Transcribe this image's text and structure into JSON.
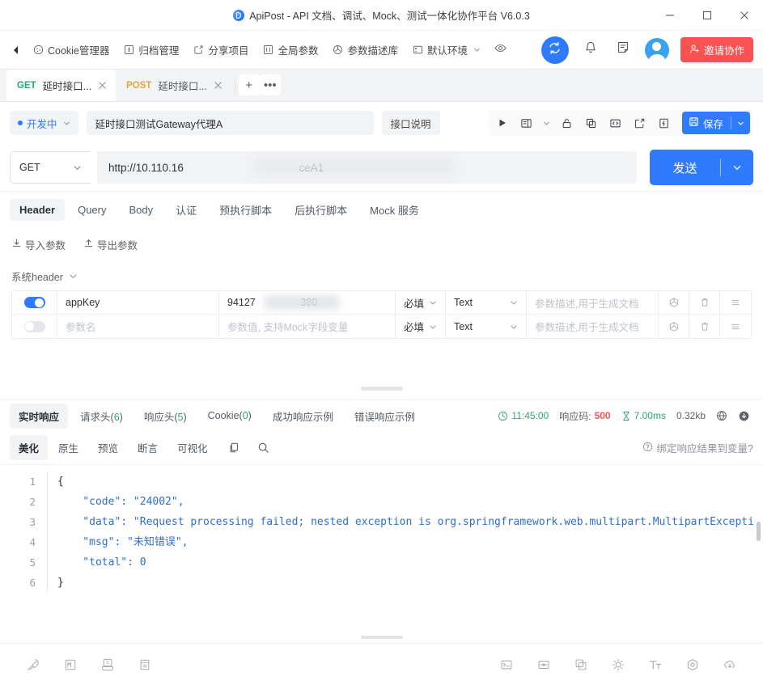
{
  "window": {
    "title": "ApiPost - API 文档、调试、Mock、测试一体化协作平台 V6.0.3",
    "minimize_label": "最小化",
    "maximize_label": "最大化",
    "close_label": "关闭"
  },
  "toolbar": {
    "back_label": "返回",
    "items": [
      {
        "label": "Cookie管理器",
        "icon": "cookie-icon"
      },
      {
        "label": "归档管理",
        "icon": "archive-icon"
      },
      {
        "label": "分享项目",
        "icon": "share-icon"
      },
      {
        "label": "全局参数",
        "icon": "global-params-icon"
      },
      {
        "label": "参数描述库",
        "icon": "param-library-icon"
      },
      {
        "label": "默认环境",
        "icon": "environment-icon",
        "has_chevron": true
      }
    ],
    "eye_icon": "eye-icon",
    "sync_icon": "sync-icon",
    "bell_icon": "bell-icon",
    "note_icon": "note-icon",
    "avatar": "user-avatar",
    "invite_label": "邀请协作"
  },
  "tabs": {
    "items": [
      {
        "method": "GET",
        "title": "延时接口...",
        "active": true
      },
      {
        "method": "POST",
        "title": "延时接口...",
        "active": false
      }
    ],
    "add_label": "+",
    "more_label": "•••"
  },
  "request": {
    "status_label": "开发中",
    "name_value": "延时接口测试Gateway代理A",
    "desc_label": "接口说明",
    "actions": [
      {
        "name": "run-icon"
      },
      {
        "name": "doc-icon"
      },
      {
        "name": "chevron-down-icon"
      },
      {
        "name": "unlock-icon"
      },
      {
        "name": "copy-icon"
      },
      {
        "name": "code-icon"
      },
      {
        "name": "export-icon"
      },
      {
        "name": "lightning-icon"
      }
    ],
    "save_label": "保存",
    "method": "GET",
    "url": "http://10.110.16",
    "url_tail": "ceA1",
    "send_label": "发送"
  },
  "req_tabs": [
    {
      "label": "Header",
      "active": true
    },
    {
      "label": "Query",
      "active": false
    },
    {
      "label": "Body",
      "active": false
    },
    {
      "label": "认证",
      "active": false
    },
    {
      "label": "预执行脚本",
      "active": false
    },
    {
      "label": "后执行脚本",
      "active": false
    },
    {
      "label": "Mock 服务",
      "active": false
    }
  ],
  "param_actions": {
    "import_label": "导入参数",
    "export_label": "导出参数",
    "system_header_label": "系统header"
  },
  "param_table": {
    "required_label": "必填",
    "type_label": "Text",
    "desc_placeholder": "参数描述,用于生成文档",
    "name_placeholder": "参数名",
    "value_placeholder": "参数值, 支持Mock字段变量",
    "rows": [
      {
        "enabled": true,
        "name": "appKey",
        "value": "94127",
        "value_tail": "380",
        "required": "必填",
        "type": "Text",
        "desc": ""
      },
      {
        "enabled": false,
        "name": "",
        "value": "",
        "value_tail": "",
        "required": "必填",
        "type": "Text",
        "desc": ""
      }
    ]
  },
  "response": {
    "tabs": [
      {
        "label": "实时响应",
        "active": true
      },
      {
        "label": "请求头(",
        "count": "6",
        "suffix": ")",
        "active": false
      },
      {
        "label": "响应头(",
        "count": "5",
        "suffix": ")",
        "active": false
      },
      {
        "label": "Cookie(",
        "count": "0",
        "suffix": ")",
        "active": false
      },
      {
        "label": "成功响应示例",
        "active": false
      },
      {
        "label": "错误响应示例",
        "active": false
      }
    ],
    "time": "11:45:00",
    "code_label": "响应码:",
    "code_value": "500",
    "duration": "7.00ms",
    "size": "0.32kb",
    "globe_icon": "globe-icon",
    "download_icon": "download-icon",
    "view_tabs": [
      {
        "label": "美化",
        "active": true
      },
      {
        "label": "原生",
        "active": false
      },
      {
        "label": "预览",
        "active": false
      },
      {
        "label": "断言",
        "active": false
      },
      {
        "label": "可视化",
        "active": false
      }
    ],
    "copy_icon": "copy-icon",
    "search_icon": "search-icon",
    "bind_var_label": "绑定响应结果到变量?",
    "help_icon": "help-icon"
  },
  "code": {
    "lines": [
      {
        "no": "1",
        "text": "{"
      },
      {
        "no": "2",
        "text": "    \"code\": \"24002\","
      },
      {
        "no": "3",
        "text": "    \"data\": \"Request processing failed; nested exception is org.springframework.web.multipart.MultipartExcepti"
      },
      {
        "no": "4",
        "text": "    \"msg\": \"未知错误\","
      },
      {
        "no": "5",
        "text": "    \"total\": 0"
      },
      {
        "no": "6",
        "text": "}"
      }
    ]
  },
  "statusbar": {
    "left_icons": [
      {
        "name": "rocket-icon"
      },
      {
        "name": "markdown-icon"
      },
      {
        "name": "inbox-icon"
      },
      {
        "name": "panel-icon"
      }
    ],
    "right_icons": [
      {
        "name": "console-icon"
      },
      {
        "name": "target-icon"
      },
      {
        "name": "layers-icon"
      },
      {
        "name": "brightness-icon"
      },
      {
        "name": "font-size-icon"
      },
      {
        "name": "settings-icon"
      },
      {
        "name": "cloud-download-icon"
      }
    ]
  },
  "colors": {
    "accent": "#2f7bff",
    "danger": "#fa5151",
    "success": "#2aa775",
    "get": "#2aa775",
    "post": "#e8a33d"
  }
}
